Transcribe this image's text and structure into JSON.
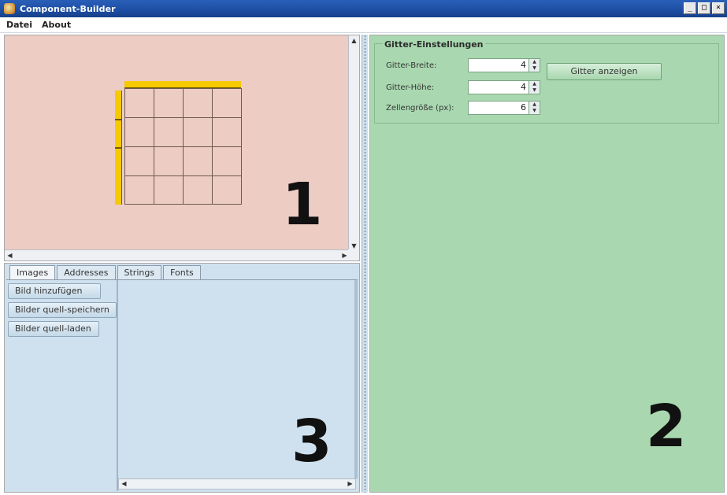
{
  "window": {
    "title": "Component-Builder",
    "controls": [
      "_",
      "□",
      "×"
    ]
  },
  "menu": [
    "Datei",
    "About"
  ],
  "panel1": {
    "label": "1",
    "grid": {
      "columns": 4,
      "rows": 4
    }
  },
  "panel3": {
    "label": "3",
    "tabs": [
      "Images",
      "Addresses",
      "Strings",
      "Fonts"
    ],
    "active_tab": "Images",
    "buttons": [
      "Bild hinzufügen",
      "Bilder quell-speichern",
      "Bilder quell-laden"
    ]
  },
  "panel2": {
    "label": "2",
    "settings": {
      "title": "Gitter-Einstellungen",
      "rows": [
        {
          "label": "Gitter-Breite:",
          "value": "4"
        },
        {
          "label": "Gitter-Höhe:",
          "value": "4"
        },
        {
          "label": "Zellengröße (px):",
          "value": "6"
        }
      ],
      "show_button": "Gitter anzeigen"
    }
  }
}
